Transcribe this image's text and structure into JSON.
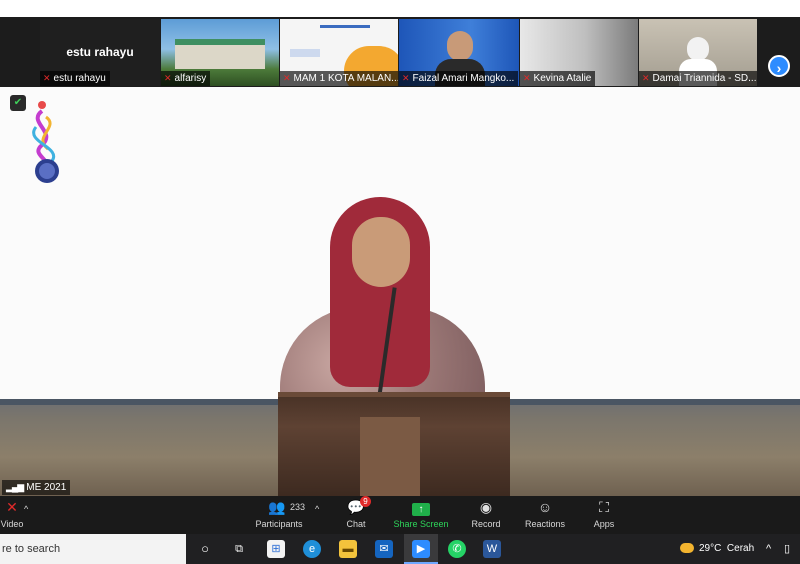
{
  "thumbnails": [
    {
      "name": "estu rahayu",
      "display": "estu rahayu"
    },
    {
      "name": "alfarisy"
    },
    {
      "name": "MAM 1 KOTA MALAN..."
    },
    {
      "name": "Faizal Amari Mangko..."
    },
    {
      "name": "Kevina Atalie"
    },
    {
      "name": "Damai Triannida - SD..."
    }
  ],
  "main_video": {
    "participant_label": "ME 2021"
  },
  "toolbar": {
    "video_label": "Video",
    "participants_label": "Participants",
    "participants_count": "233",
    "chat_label": "Chat",
    "chat_badge": "9",
    "share_label": "Share Screen",
    "record_label": "Record",
    "reactions_label": "Reactions",
    "apps_label": "Apps"
  },
  "taskbar": {
    "search_text": "re to search",
    "weather_temp": "29°C",
    "weather_desc": "Cerah"
  },
  "colors": {
    "accent_blue": "#2d8cff",
    "share_green": "#2ed35a",
    "muted_red": "#e02a2a",
    "toolbar_bg": "#1a1a1a"
  }
}
